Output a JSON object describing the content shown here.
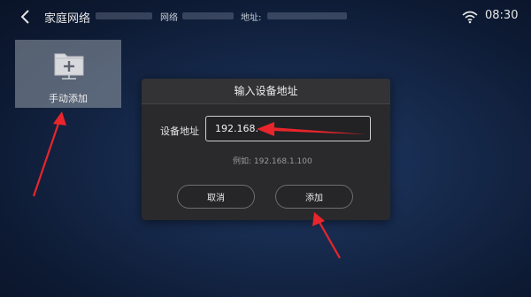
{
  "topbar": {
    "title": "家庭网络",
    "network_label": "网络",
    "address_label": "地址:",
    "time": "08:30"
  },
  "tile": {
    "label": "手动添加"
  },
  "dialog": {
    "title": "输入设备地址",
    "field_label": "设备地址",
    "field_value": "192.168.",
    "hint": "例如: 192.168.1.100",
    "cancel_label": "取消",
    "add_label": "添加"
  },
  "colors": {
    "annotation_arrow": "#e8252b",
    "dialog_bg": "#2a2a2c"
  },
  "icons": [
    "back-chevron",
    "wifi",
    "folder-plus"
  ]
}
